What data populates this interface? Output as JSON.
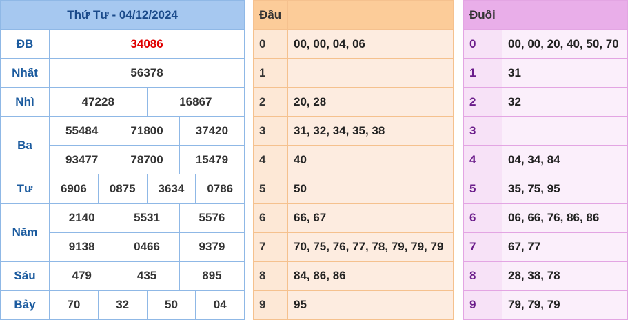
{
  "results": {
    "title": "Thứ Tư - 04/12/2024",
    "db_label": "ĐB",
    "db_value": "34086",
    "nhat_label": "Nhất",
    "nhat_value": "56378",
    "nhi_label": "Nhì",
    "nhi_values": [
      "47228",
      "16867"
    ],
    "ba_label": "Ba",
    "ba_values": [
      "55484",
      "71800",
      "37420",
      "93477",
      "78700",
      "15479"
    ],
    "tu_label": "Tư",
    "tu_values": [
      "6906",
      "0875",
      "3634",
      "0786"
    ],
    "nam_label": "Năm",
    "nam_values": [
      "2140",
      "5531",
      "5576",
      "9138",
      "0466",
      "9379"
    ],
    "sau_label": "Sáu",
    "sau_values": [
      "479",
      "435",
      "895"
    ],
    "bay_label": "Bảy",
    "bay_values": [
      "70",
      "32",
      "50",
      "04"
    ],
    "special_color": "#e00000"
  },
  "dau": {
    "header": "Đầu",
    "rows": [
      {
        "idx": "0",
        "vals": "00, 00, 04, 06"
      },
      {
        "idx": "1",
        "vals": ""
      },
      {
        "idx": "2",
        "vals": "20, 28"
      },
      {
        "idx": "3",
        "vals": "31, 32, 34, 35, 38"
      },
      {
        "idx": "4",
        "vals": "40"
      },
      {
        "idx": "5",
        "vals": "50"
      },
      {
        "idx": "6",
        "vals": "66, 67"
      },
      {
        "idx": "7",
        "vals": "70, 75, 76, 77, 78, 79, 79, 79"
      },
      {
        "idx": "8",
        "vals": "84, 86, 86"
      },
      {
        "idx": "9",
        "vals": "95"
      }
    ]
  },
  "duoi": {
    "header": "Đuôi",
    "rows": [
      {
        "idx": "0",
        "vals": "00, 00, 20, 40, 50, 70"
      },
      {
        "idx": "1",
        "vals": "31"
      },
      {
        "idx": "2",
        "vals": "32"
      },
      {
        "idx": "3",
        "vals": ""
      },
      {
        "idx": "4",
        "vals": "04, 34, 84"
      },
      {
        "idx": "5",
        "vals": "35, 75, 95"
      },
      {
        "idx": "6",
        "vals": "06, 66, 76, 86, 86"
      },
      {
        "idx": "7",
        "vals": "67, 77"
      },
      {
        "idx": "8",
        "vals": "28, 38, 78"
      },
      {
        "idx": "9",
        "vals": "79, 79, 79"
      }
    ]
  }
}
